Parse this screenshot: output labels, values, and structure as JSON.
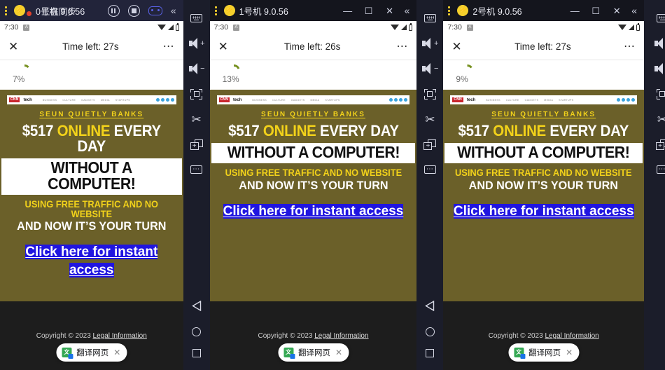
{
  "instances": [
    {
      "id": "inst-0",
      "titlebar": {
        "title": "0号机 9.0.56",
        "overlay_title": "正在同步",
        "pause_label": "暂停",
        "stop_label": "停止",
        "gamepad_label": "手柄",
        "collapse_label": "«"
      },
      "status": {
        "time": "7:30"
      },
      "appbar": {
        "close": "✕",
        "title": "Time left: 27s",
        "menu": "⋯"
      },
      "progress": {
        "percent": "7%",
        "value": 7
      }
    },
    {
      "id": "inst-1",
      "titlebar": {
        "title": "1号机 9.0.56",
        "minimize": "—",
        "maximize": "☐",
        "close": "✕",
        "collapse_label": "«"
      },
      "status": {
        "time": "7:30"
      },
      "appbar": {
        "close": "✕",
        "title": "Time left: 26s",
        "menu": "⋯"
      },
      "progress": {
        "percent": "13%",
        "value": 13
      }
    },
    {
      "id": "inst-2",
      "titlebar": {
        "title": "2号机 9.0.56",
        "minimize": "—",
        "maximize": "☐",
        "close": "✕",
        "collapse_label": "«"
      },
      "status": {
        "time": "7:30"
      },
      "appbar": {
        "close": "✕",
        "title": "Time left: 27s",
        "menu": "⋯"
      },
      "progress": {
        "percent": "9%",
        "value": 9
      }
    }
  ],
  "ad": {
    "mininav": {
      "logo": "CNN",
      "logo_sub": "tech",
      "links": [
        "BUSINESS",
        "CULTURE",
        "GADGETS",
        "MEDIA",
        "STARTUPS"
      ]
    },
    "kicker": "SEUN QUIETLY BANKS",
    "headline_1_a": "$517 ",
    "headline_1_b": "ONLINE",
    "headline_1_c": " EVERY DAY",
    "headline_2": "WITHOUT A COMPUTER!",
    "subline_1": "USING FREE TRAFFIC AND NO WEBSITE",
    "subline_2": "AND NOW IT’S YOUR TURN",
    "cta": "Click here for instant access",
    "footer_copyright": "Copyright © 2023 ",
    "footer_link": "Legal Information",
    "colors": {
      "background": "#6b6029",
      "accent_yellow": "#f2d21a",
      "cta_highlight": "#2015e0",
      "footer_bg": "#1d1d1d"
    }
  },
  "translate_bubble": {
    "icon": "translate-icon",
    "label": "翻译网页",
    "close": "✕"
  },
  "toolbar": {
    "items": [
      {
        "name": "keyboard",
        "label": "键盘"
      },
      {
        "name": "volume-up",
        "label": "音量+"
      },
      {
        "name": "volume-down",
        "label": "音量-"
      },
      {
        "name": "fullscreen",
        "label": "全屏"
      },
      {
        "name": "screenshot",
        "label": "截图"
      },
      {
        "name": "new-window",
        "label": "新窗口"
      },
      {
        "name": "more",
        "label": "更多"
      }
    ],
    "nav": [
      {
        "name": "back",
        "label": "返回"
      },
      {
        "name": "home",
        "label": "主页"
      },
      {
        "name": "recents",
        "label": "任务"
      }
    ]
  }
}
